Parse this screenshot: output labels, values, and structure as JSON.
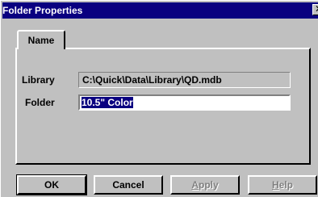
{
  "window": {
    "title": "Folder Properties",
    "close_glyph": "✕"
  },
  "tabs": [
    {
      "label": "Name",
      "active": true
    }
  ],
  "fields": {
    "library_label": "Library",
    "library_value": "C:\\Quick\\Data\\Library\\QD.mdb",
    "folder_label": "Folder",
    "folder_value": "10.5\" Color"
  },
  "buttons": {
    "ok": "OK",
    "cancel": "Cancel",
    "apply": "Apply",
    "help": "Help"
  },
  "colors": {
    "title_bar": "#0a0080",
    "face": "#c0c0c0",
    "selection": "#0a0080"
  }
}
